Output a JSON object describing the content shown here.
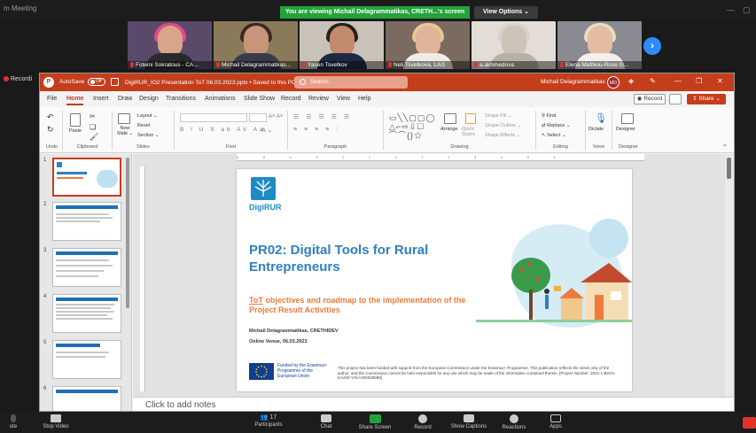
{
  "zoom": {
    "title": "m Meeting",
    "banner": "You are viewing Michail Delagrammatikas, CRETH...'s screen",
    "view_options": "View Options ⌄",
    "participants": [
      {
        "name": "Foteini Sokratous - CA..."
      },
      {
        "name": "Michail Delagrammatikas..."
      },
      {
        "name": "Yasen Tsvetkov"
      },
      {
        "name": "Neli Tsvetkova, LAG"
      },
      {
        "name": "a.akhmedova"
      },
      {
        "name": "Elena Mathiou-Rose G..."
      }
    ],
    "recording": "Recordi",
    "bottom": {
      "mute": "ute",
      "stop_video": "Stop Video",
      "participants": "Participants",
      "participants_count": "17",
      "chat": "Chat",
      "share": "Share Screen",
      "record": "Record",
      "captions": "Show Captions",
      "reactions": "Reactions",
      "apps": "Apps"
    }
  },
  "ppt": {
    "autosave": "AutoSave",
    "toggle": "Off",
    "filename": "DigiRUR_IO2 Presentation ToT 06.03.2023.pptx • Saved to this PC ⌄",
    "search": "Search",
    "user": "Michail Delagrammatikas",
    "avatar": "MD",
    "menu": [
      "File",
      "Home",
      "Insert",
      "Draw",
      "Design",
      "Transitions",
      "Animations",
      "Slide Show",
      "Record",
      "Review",
      "View",
      "Help"
    ],
    "record_btn": "◉ Record",
    "share_btn": "⇪ Share ⌄",
    "ribbon": {
      "undo": "Undo",
      "clipboard": "Clipboard",
      "paste": "Paste",
      "new_slide": "New Slide ⌄",
      "layout": "Layout ⌄",
      "reset": "Reset",
      "section": "Section ⌄",
      "slides": "Slides",
      "font": "Font",
      "paragraph": "Paragraph",
      "drawing": "Drawing",
      "arrange": "Arrange",
      "quick_styles": "Quick Styles",
      "shape_fill": "Shape Fill ⌄",
      "shape_outline": "Shape Outline ⌄",
      "shape_effects": "Shape Effects ⌄",
      "find": "Find",
      "replace": "Replace ⌄",
      "select": "Select ⌄",
      "editing": "Editing",
      "dictate": "Dictate",
      "voice": "Voice",
      "designer": "Designer",
      "designer_group": "Designer"
    },
    "slide": {
      "logo": "DigiRUR",
      "title": "PR02: Digital Tools for Rural Entrepreneurs",
      "subtitle_tot": "ToT",
      "subtitle_rest": " objectives and roadmap to the implementation of the Project Result Activities",
      "author": "Michail Delagrammatikas, CRETHIDEV",
      "venue": "Online Venue, 06.03.2023",
      "eu_text": "Funded by the Erasmus+ Programme of the European Union",
      "disclaimer": "This project has been funded with support from the European Commission under the Erasmus+ Programme. This publication reflects the views only of the author, and the Commission cannot be held responsible for any use which may be made of the information contained therein. [Project Number: 2021-1-BG01-KA220-YOU-000029589]"
    },
    "thumb_numbers": [
      "1",
      "2",
      "3",
      "4",
      "5",
      "6"
    ],
    "notes_placeholder": "Click to add notes"
  },
  "colors": {
    "ppt_accent": "#c43e1c",
    "zoom_green": "#23a33a",
    "slide_blue": "#2f7fc1",
    "slide_orange": "#ee7b3c"
  }
}
